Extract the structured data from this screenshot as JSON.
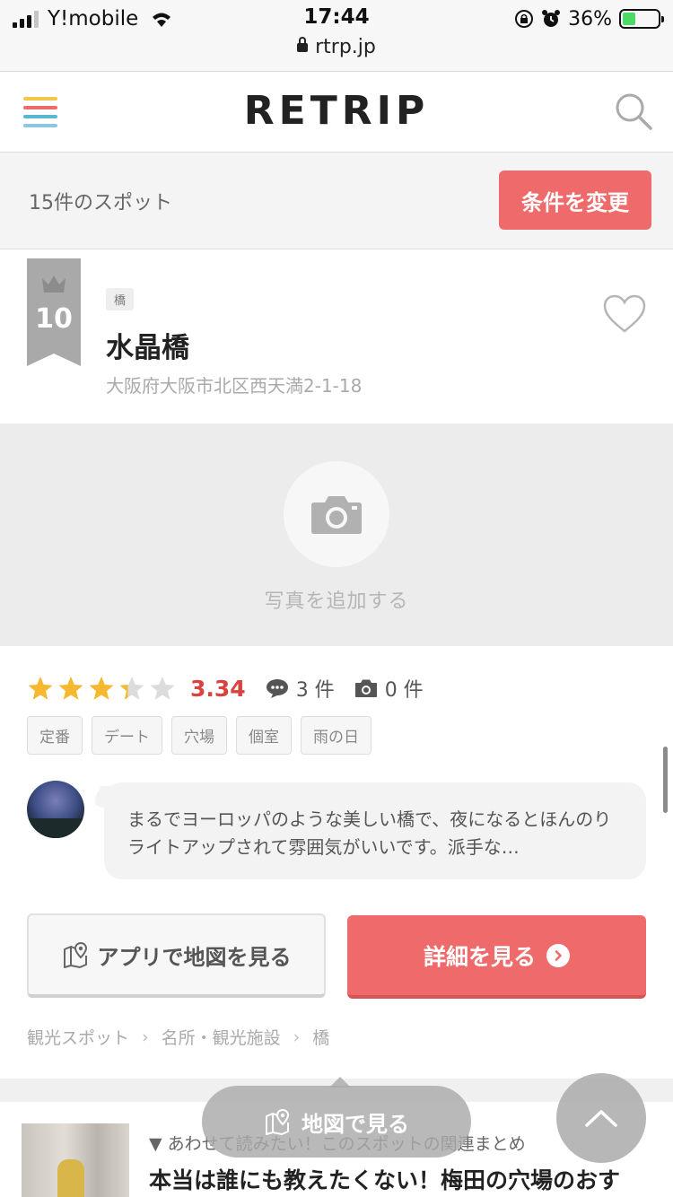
{
  "status_bar": {
    "carrier": "Y!mobile",
    "time": "17:44",
    "battery": "36%",
    "url": "rtrp.jp"
  },
  "header": {
    "logo": "RETRIP",
    "hamburger_colors": [
      "#f0c94a",
      "#ef6b6b",
      "#57b8cf",
      "#8cc7e0"
    ]
  },
  "filter": {
    "count_text": "15件のスポット",
    "change_button": "条件を変更"
  },
  "spot": {
    "rank": "10",
    "category": "橋",
    "name": "水晶橋",
    "address": "大阪府大阪市北区西天満2-1-18",
    "photo_label": "写真を追加する",
    "rating": 3.34,
    "rating_text": "3.34",
    "review_count": "3 件",
    "photo_count": "0 件",
    "tags": [
      "定番",
      "デート",
      "穴場",
      "個室",
      "雨の日"
    ],
    "review_text": "まるでヨーロッパのような美しい橋で、夜になるとほんのりライトアップされて雰囲気がいいです。派手な…",
    "map_button": "アプリで地図を見る",
    "detail_button": "詳細を見る",
    "breadcrumbs": [
      "観光スポット",
      "名所・観光施設",
      "橋"
    ]
  },
  "related": {
    "subtitle": "▼ あわせて読みたい！このスポットの関連まとめ",
    "title": "本当は誰にも教えたくない！梅田の穴場のおす"
  },
  "floating": {
    "map_label": "地図で見る"
  },
  "colors": {
    "accent": "#ef6b6b",
    "score": "#d8423f",
    "star": "#f5b82e"
  }
}
